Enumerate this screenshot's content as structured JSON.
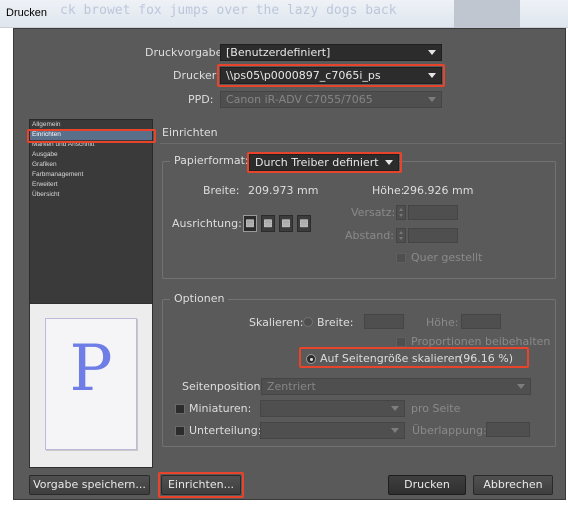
{
  "window": {
    "title": "Drucken",
    "ghost_text": "ck browet fox jumps over the lazy dogs back"
  },
  "top": {
    "druckvorgabe_label": "Druckvorgabe:",
    "druckvorgabe_value": "[Benutzerdefiniert]",
    "drucker_label": "Drucker:",
    "drucker_value": "\\\\ps05\\p0000897_c7065i_ps",
    "ppd_label": "PPD:",
    "ppd_value": "Canon iR-ADV C7055/7065"
  },
  "sidebar": {
    "items": [
      {
        "label": "Allgemein"
      },
      {
        "label": "Einrichten"
      },
      {
        "label": "Marken und Anschnitt"
      },
      {
        "label": "Ausgabe"
      },
      {
        "label": "Grafiken"
      },
      {
        "label": "Farbmanagement"
      },
      {
        "label": "Erweitert"
      },
      {
        "label": "Übersicht"
      }
    ],
    "active_index": 1
  },
  "preview": {
    "letter": "P"
  },
  "einrichten": {
    "section_title": "Einrichten",
    "papierformat_label": "Papierformat:",
    "papierformat_value": "Durch Treiber definiert",
    "breite_label": "Breite:",
    "breite_value": "209.973 mm",
    "hoehe_label": "Höhe:",
    "hoehe_value": "296.926 mm",
    "ausrichtung_label": "Ausrichtung:",
    "versatz_label": "Versatz:",
    "abstand_label": "Abstand:",
    "quer_label": "Quer gestellt"
  },
  "optionen": {
    "section_title": "Optionen",
    "skalieren_label": "Skalieren:",
    "breite_label": "Breite:",
    "hoehe_label": "Höhe:",
    "proportionen_label": "Proportionen beibehalten",
    "auf_seite_label": "Auf Seitengröße skalieren",
    "auf_seite_percent": "(96.16 %)",
    "seitenposition_label": "Seitenposition:",
    "seitenposition_value": "Zentriert",
    "miniaturen_label": "Miniaturen:",
    "pro_seite_label": "pro Seite",
    "unterteilung_label": "Unterteilung:",
    "ueberlappung_label": "Überlappung:"
  },
  "buttons": {
    "vorgabe_speichern": "Vorgabe speichern...",
    "einrichten": "Einrichten...",
    "drucken": "Drucken",
    "abbrechen": "Abbrechen"
  },
  "colors": {
    "highlight": "#e8432b",
    "panel": "#5a5a5a",
    "preview_letter": "#6f7ee6"
  }
}
